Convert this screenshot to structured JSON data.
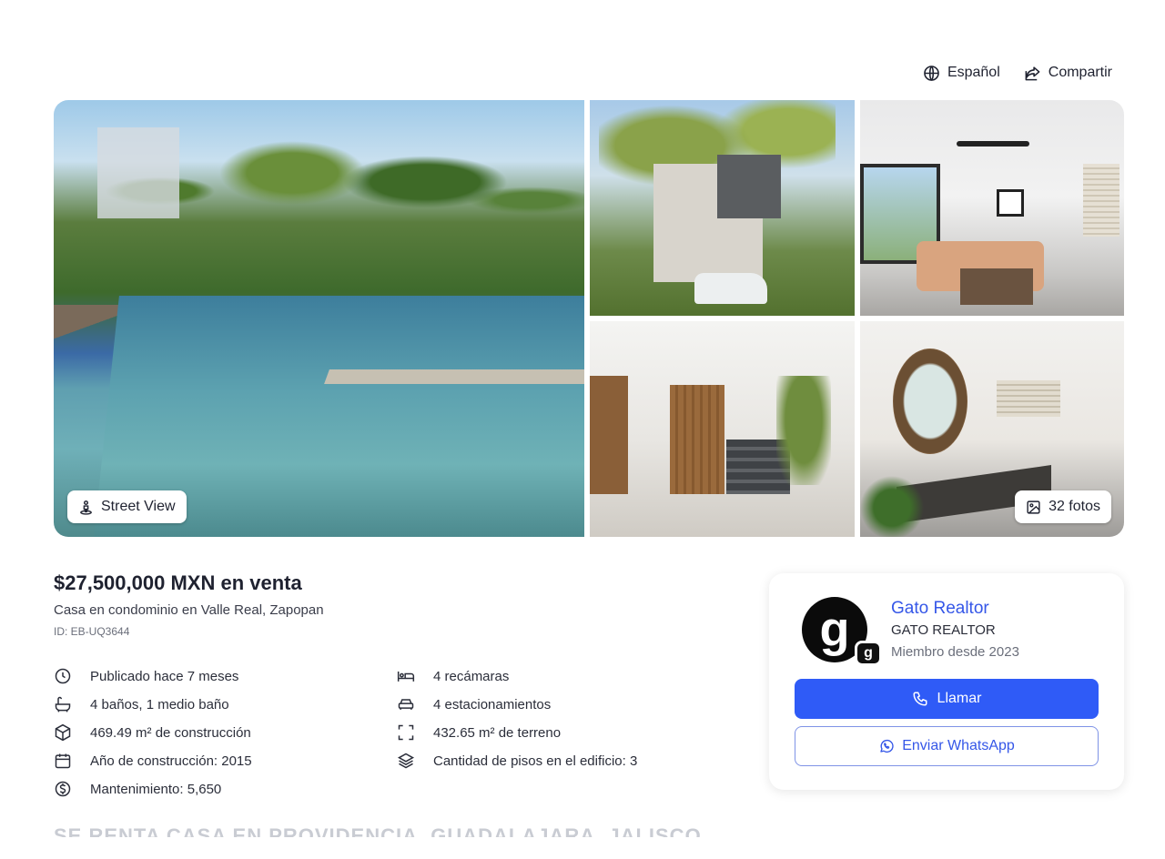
{
  "top_actions": {
    "language_label": "Español",
    "share_label": "Compartir"
  },
  "gallery": {
    "street_view_label": "Street View",
    "photos_count_label": "32 fotos"
  },
  "listing": {
    "price": "$27,500,000 MXN en venta",
    "subtitle": "Casa en condominio en Valle Real, Zapopan",
    "id": "ID: EB-UQ3644"
  },
  "features": [
    {
      "icon": "clock-icon",
      "text": "Publicado hace 7 meses"
    },
    {
      "icon": "bed-icon",
      "text": "4 recámaras"
    },
    {
      "icon": "bathtub-icon",
      "text": "4 baños, 1 medio baño"
    },
    {
      "icon": "car-icon",
      "text": "4 estacionamientos"
    },
    {
      "icon": "cube-icon",
      "text": "469.49 m² de construcción"
    },
    {
      "icon": "area-frame-icon",
      "text": "432.65 m² de terreno"
    },
    {
      "icon": "calendar-icon",
      "text": "Año de construcción: 2015"
    },
    {
      "icon": "layers-icon",
      "text": "Cantidad de pisos en el edificio: 3"
    },
    {
      "icon": "dollar-circle-icon",
      "text": "Mantenimiento: 5,650"
    }
  ],
  "faded_heading": "SE RENTA CASA EN PROVIDENCIA, GUADALAJARA, JALISCO",
  "agent": {
    "logo_letter": "g",
    "badge_letter": "g",
    "name": "Gato Realtor",
    "company": "GATO REALTOR",
    "member_since": "Miembro desde 2023",
    "call_label": "Llamar",
    "whatsapp_label": "Enviar WhatsApp"
  },
  "colors": {
    "accent": "#2f5bf7",
    "link": "#3557e8",
    "text": "#1f2230"
  }
}
